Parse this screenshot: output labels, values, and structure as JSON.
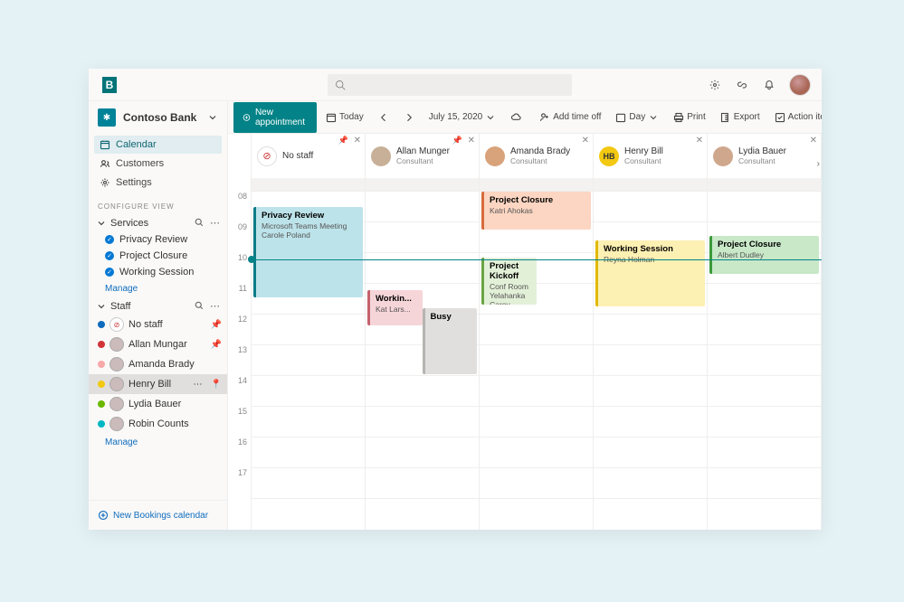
{
  "app": {
    "brand": "B"
  },
  "titlebar": {
    "search_placeholder": ""
  },
  "org": {
    "name": "Contoso Bank"
  },
  "nav": {
    "calendar": "Calendar",
    "customers": "Customers",
    "settings": "Settings"
  },
  "sidebar": {
    "configure_label": "CONFIGURE VIEW",
    "services_label": "Services",
    "services": [
      {
        "label": "Privacy Review"
      },
      {
        "label": "Project Closure"
      },
      {
        "label": "Working Session"
      }
    ],
    "manage_label": "Manage",
    "staff_label": "Staff",
    "staff": [
      {
        "label": "No staff",
        "status": "#0f6cbd",
        "pinned": true,
        "no_avatar": true
      },
      {
        "label": "Allan Mungar",
        "status": "#d13438",
        "pinned": true
      },
      {
        "label": "Amanda Brady",
        "status": "#f7a8a8",
        "pinned": false
      },
      {
        "label": "Henry Bill",
        "status": "#f2c811",
        "pinned": false,
        "hovered": true,
        "pin_outline": true
      },
      {
        "label": "Lydia Bauer",
        "status": "#6bb700",
        "pinned": false
      },
      {
        "label": "Robin Counts",
        "status": "#00b7c3",
        "pinned": false
      }
    ],
    "new_calendar_label": "New Bookings calendar"
  },
  "toolbar": {
    "new_appointment": "New appointment",
    "today": "Today",
    "date": "July 15, 2020",
    "add_time_off": "Add time off",
    "view": "Day",
    "print": "Print",
    "export": "Export",
    "action_items": "Action items"
  },
  "calendar": {
    "time_start": 8,
    "time_end": 17,
    "now_row": 2.2,
    "columns": [
      {
        "name": "No staff",
        "role": "",
        "pinned": true,
        "avatar_bg": "#fff",
        "avatar_badge": true,
        "events": [
          {
            "title": "Privacy Review",
            "sub1": "Microsoft Teams Meeting",
            "sub2": "Carole Poland",
            "start": 0.5,
            "span": 3.0,
            "bg": "#bde3ea",
            "bar": "#0c7b86"
          }
        ]
      },
      {
        "name": "Allan Munger",
        "role": "Consultant",
        "pinned": true,
        "avatar_bg": "#c7b097",
        "events": [
          {
            "title": "Workin...",
            "sub1": "Kat Lars...",
            "start": 3.2,
            "span": 1.2,
            "bg": "#f6d5d9",
            "bar": "#c5616c",
            "half": "left"
          },
          {
            "title": "Busy",
            "start": 3.8,
            "span": 2.2,
            "bg": "#e1dfdd",
            "bar": "#b6b4b1",
            "half": "right"
          }
        ]
      },
      {
        "name": "Amanda Brady",
        "role": "Consultant",
        "avatar_bg": "#d8a27a",
        "events": [
          {
            "title": "Project Closure",
            "sub1": "Katri Ahokas",
            "start": 0.0,
            "span": 1.3,
            "bg": "#fcd6c2",
            "bar": "#d86c3a"
          },
          {
            "title": "Project Kickoff",
            "sub1": "Conf Room Yelahanka",
            "sub2": "Carey Richard",
            "start": 2.15,
            "span": 1.6,
            "bg": "#e3f0d8",
            "bar": "#6ba544",
            "half": "left"
          }
        ]
      },
      {
        "name": "Henry Bill",
        "role": "Consultant",
        "avatar_bg": "#f2c811",
        "initials": "HB",
        "events": [
          {
            "title": "Working Session",
            "sub1": "Reyna Holman",
            "start": 1.6,
            "span": 2.2,
            "bg": "#fdf0b3",
            "bar": "#e1b900"
          }
        ]
      },
      {
        "name": "Lydia Bauer",
        "role": "Consultant",
        "avatar_bg": "#cfa78d",
        "events": [
          {
            "title": "Project Closure",
            "sub1": "Albert Dudley",
            "start": 1.45,
            "span": 1.3,
            "bg": "#c8e8c8",
            "bar": "#3b9b3b"
          }
        ]
      }
    ]
  }
}
